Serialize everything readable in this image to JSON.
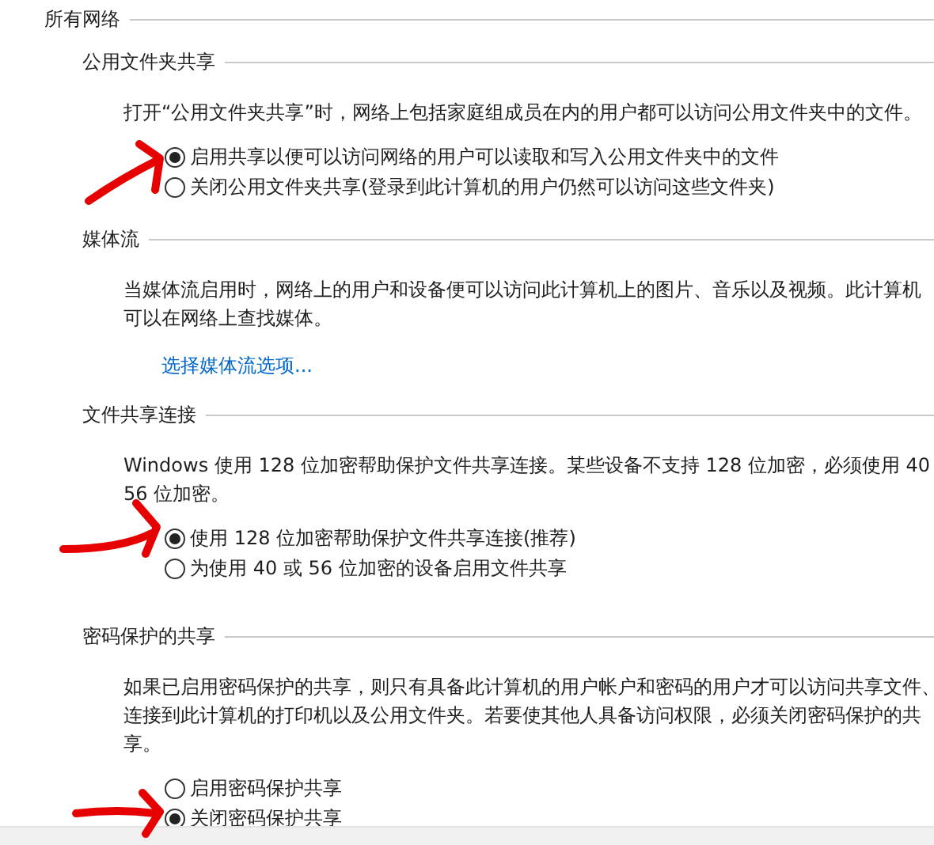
{
  "group_title": "所有网络",
  "sections": [
    {
      "title": "公用文件夹共享",
      "description": [
        "打开“公用文件夹共享”时，网络上包括家庭组成员在内的用户都可以访问公用文件夹中的文件。"
      ],
      "options": [
        {
          "label": "启用共享以便可以访问网络的用户可以读取和写入公用文件夹中的文件",
          "selected": true
        },
        {
          "label": "关闭公用文件夹共享(登录到此计算机的用户仍然可以访问这些文件夹)",
          "selected": false
        }
      ]
    },
    {
      "title": "媒体流",
      "description": [
        "当媒体流启用时，网络上的用户和设备便可以访问此计算机上的图片、音乐以及视频。此计算机",
        "可以在网络上查找媒体。"
      ],
      "link": "选择媒体流选项..."
    },
    {
      "title": "文件共享连接",
      "description": [
        "Windows 使用 128 位加密帮助保护文件共享连接。某些设备不支持 128 位加密，必须使用 40",
        "56 位加密。"
      ],
      "options": [
        {
          "label": "使用 128 位加密帮助保护文件共享连接(推荐)",
          "selected": true
        },
        {
          "label": "为使用 40 或 56 位加密的设备启用文件共享",
          "selected": false
        }
      ]
    },
    {
      "title": "密码保护的共享",
      "description": [
        "如果已启用密码保护的共享，则只有具备此计算机的用户帐户和密码的用户才可以访问共享文件、",
        "连接到此计算机的打印机以及公用文件夹。若要使其他人具备访问权限，必须关闭密码保护的共",
        "享。"
      ],
      "options": [
        {
          "label": "启用密码保护共享",
          "selected": false
        },
        {
          "label": "关闭密码保护共享",
          "selected": true
        }
      ]
    }
  ]
}
